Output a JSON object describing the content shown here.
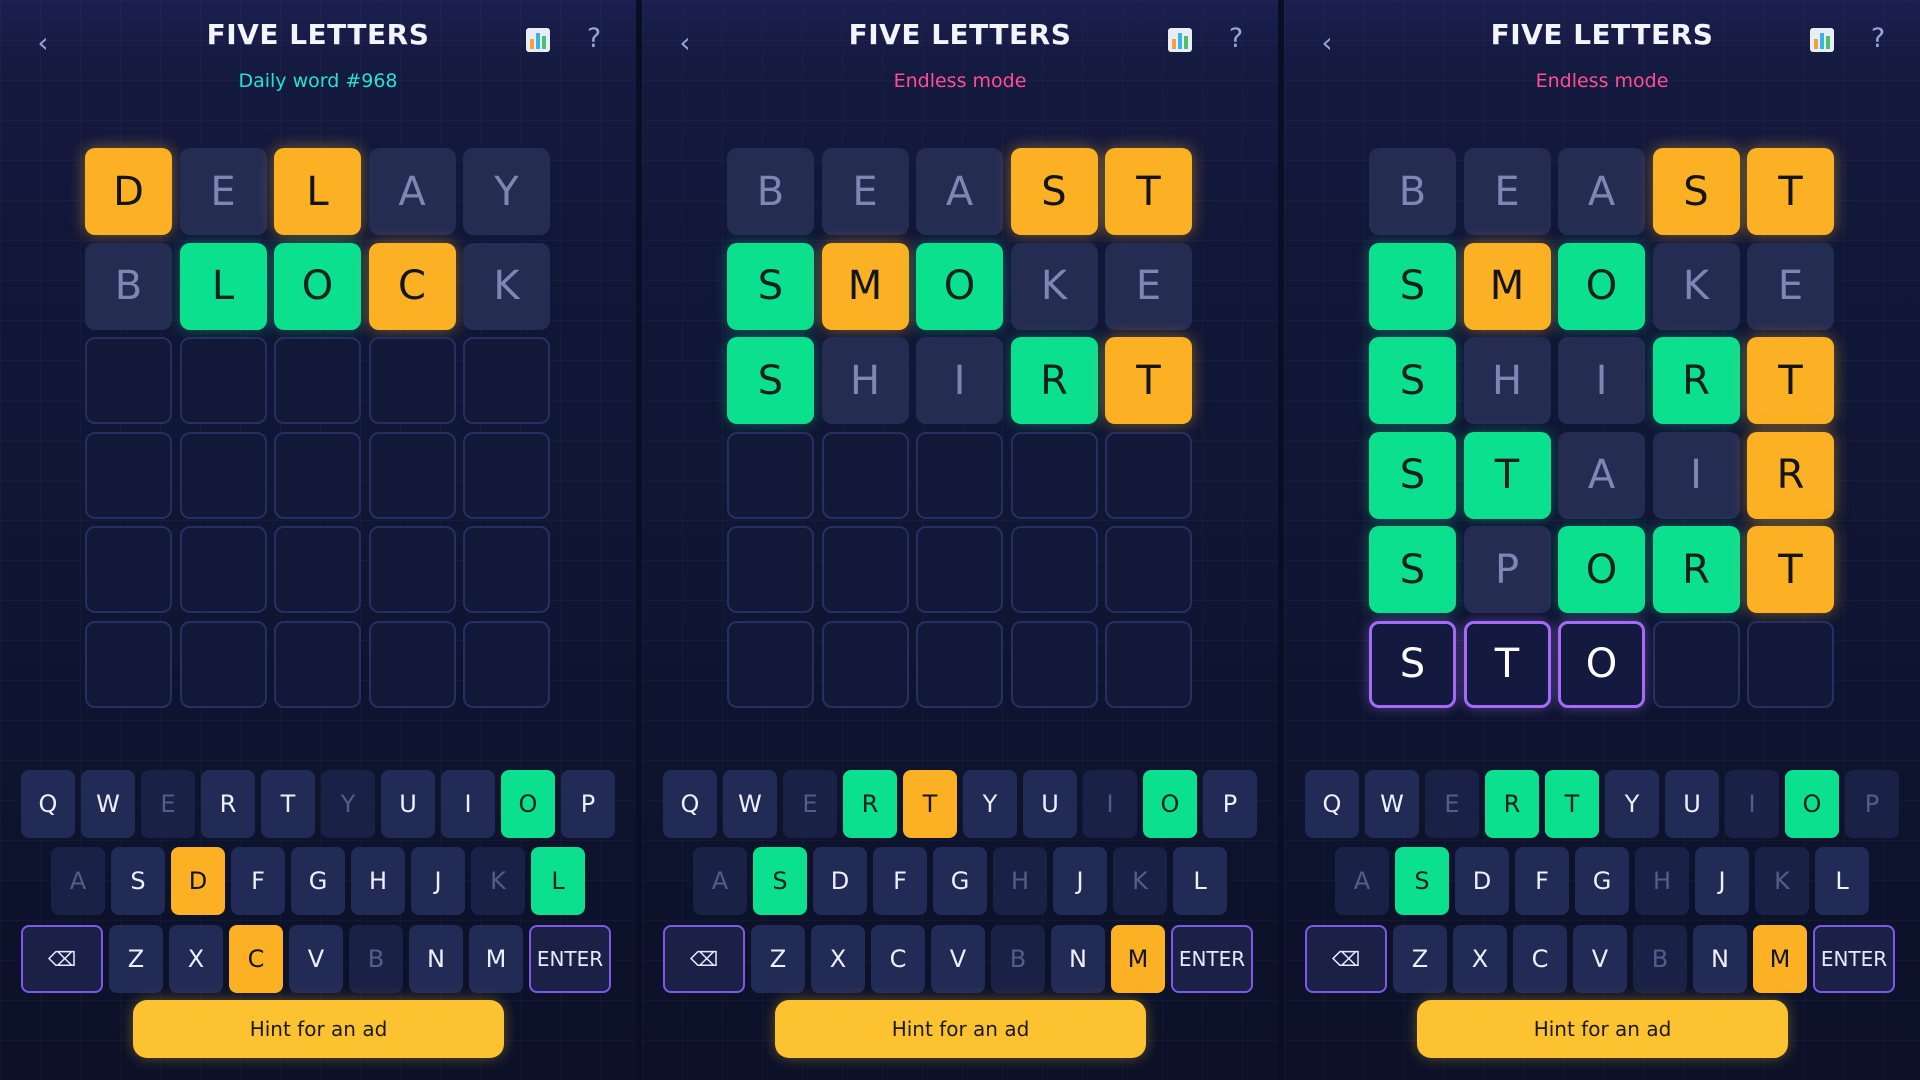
{
  "colors": {
    "present": "#fbb123",
    "correct": "#0be08f",
    "absent_tile": "#252c52",
    "daily_subtitle": "#26e3d0",
    "endless_subtitle": "#ff4f92",
    "hint_button": "#fcc22f"
  },
  "icons": {
    "back": "chevron-left-icon",
    "stats": "bar-chart-icon",
    "help": "question-mark-icon",
    "backspace": "backspace-icon"
  },
  "keyboard_layout": [
    [
      "Q",
      "W",
      "E",
      "R",
      "T",
      "Y",
      "U",
      "I",
      "O",
      "P"
    ],
    [
      "A",
      "S",
      "D",
      "F",
      "G",
      "H",
      "J",
      "K",
      "L"
    ],
    [
      "BACK",
      "Z",
      "X",
      "C",
      "V",
      "B",
      "N",
      "M",
      "ENTER"
    ]
  ],
  "panels": [
    {
      "title": "FIVE LETTERS",
      "subtitle": "Daily word #968",
      "subtitle_mode": "daily",
      "back_glyph": "‹",
      "help_glyph": "?",
      "board": [
        [
          [
            "D",
            "present"
          ],
          [
            "E",
            "absent"
          ],
          [
            "L",
            "present"
          ],
          [
            "A",
            "absent"
          ],
          [
            "Y",
            "absent"
          ]
        ],
        [
          [
            "B",
            "absent"
          ],
          [
            "L",
            "correct"
          ],
          [
            "O",
            "correct"
          ],
          [
            "C",
            "present"
          ],
          [
            "K",
            "absent"
          ]
        ],
        [
          [
            "",
            "empty"
          ],
          [
            "",
            "empty"
          ],
          [
            "",
            "empty"
          ],
          [
            "",
            "empty"
          ],
          [
            "",
            "empty"
          ]
        ],
        [
          [
            "",
            "empty"
          ],
          [
            "",
            "empty"
          ],
          [
            "",
            "empty"
          ],
          [
            "",
            "empty"
          ],
          [
            "",
            "empty"
          ]
        ],
        [
          [
            "",
            "empty"
          ],
          [
            "",
            "empty"
          ],
          [
            "",
            "empty"
          ],
          [
            "",
            "empty"
          ],
          [
            "",
            "empty"
          ]
        ],
        [
          [
            "",
            "empty"
          ],
          [
            "",
            "empty"
          ],
          [
            "",
            "empty"
          ],
          [
            "",
            "empty"
          ],
          [
            "",
            "empty"
          ]
        ]
      ],
      "key_states": {
        "E": "absent",
        "Y": "absent",
        "O": "correct",
        "A": "absent",
        "D": "present",
        "K": "absent",
        "L": "correct",
        "C": "present",
        "B": "absent"
      },
      "backspace_glyph": "⌫",
      "enter_label": "ENTER",
      "hint_label": "Hint for an ad"
    },
    {
      "title": "FIVE LETTERS",
      "subtitle": "Endless mode",
      "subtitle_mode": "endless",
      "back_glyph": "‹",
      "help_glyph": "?",
      "board": [
        [
          [
            "B",
            "absent"
          ],
          [
            "E",
            "absent"
          ],
          [
            "A",
            "absent"
          ],
          [
            "S",
            "present"
          ],
          [
            "T",
            "present"
          ]
        ],
        [
          [
            "S",
            "correct"
          ],
          [
            "M",
            "present"
          ],
          [
            "O",
            "correct"
          ],
          [
            "K",
            "absent"
          ],
          [
            "E",
            "absent"
          ]
        ],
        [
          [
            "S",
            "correct"
          ],
          [
            "H",
            "absent"
          ],
          [
            "I",
            "absent"
          ],
          [
            "R",
            "correct"
          ],
          [
            "T",
            "present"
          ]
        ],
        [
          [
            "",
            "empty"
          ],
          [
            "",
            "empty"
          ],
          [
            "",
            "empty"
          ],
          [
            "",
            "empty"
          ],
          [
            "",
            "empty"
          ]
        ],
        [
          [
            "",
            "empty"
          ],
          [
            "",
            "empty"
          ],
          [
            "",
            "empty"
          ],
          [
            "",
            "empty"
          ],
          [
            "",
            "empty"
          ]
        ],
        [
          [
            "",
            "empty"
          ],
          [
            "",
            "empty"
          ],
          [
            "",
            "empty"
          ],
          [
            "",
            "empty"
          ],
          [
            "",
            "empty"
          ]
        ]
      ],
      "key_states": {
        "E": "absent",
        "R": "correct",
        "T": "present",
        "I": "absent",
        "O": "correct",
        "A": "absent",
        "S": "correct",
        "H": "absent",
        "K": "absent",
        "B": "absent",
        "M": "present"
      },
      "backspace_glyph": "⌫",
      "enter_label": "ENTER",
      "hint_label": "Hint for an ad"
    },
    {
      "title": "FIVE LETTERS",
      "subtitle": "Endless mode",
      "subtitle_mode": "endless",
      "back_glyph": "‹",
      "help_glyph": "?",
      "board": [
        [
          [
            "B",
            "absent"
          ],
          [
            "E",
            "absent"
          ],
          [
            "A",
            "absent"
          ],
          [
            "S",
            "present"
          ],
          [
            "T",
            "present"
          ]
        ],
        [
          [
            "S",
            "correct"
          ],
          [
            "M",
            "present"
          ],
          [
            "O",
            "correct"
          ],
          [
            "K",
            "absent"
          ],
          [
            "E",
            "absent"
          ]
        ],
        [
          [
            "S",
            "correct"
          ],
          [
            "H",
            "absent"
          ],
          [
            "I",
            "absent"
          ],
          [
            "R",
            "correct"
          ],
          [
            "T",
            "present"
          ]
        ],
        [
          [
            "S",
            "correct"
          ],
          [
            "T",
            "correct"
          ],
          [
            "A",
            "absent"
          ],
          [
            "I",
            "absent"
          ],
          [
            "R",
            "present"
          ]
        ],
        [
          [
            "S",
            "correct"
          ],
          [
            "P",
            "absent"
          ],
          [
            "O",
            "correct"
          ],
          [
            "R",
            "correct"
          ],
          [
            "T",
            "present"
          ]
        ],
        [
          [
            "S",
            "typed"
          ],
          [
            "T",
            "typed"
          ],
          [
            "O",
            "typed"
          ],
          [
            "",
            "empty"
          ],
          [
            "",
            "empty"
          ]
        ]
      ],
      "key_states": {
        "E": "absent",
        "R": "correct",
        "T": "correct",
        "I": "absent",
        "O": "correct",
        "P": "absent",
        "A": "absent",
        "S": "correct",
        "H": "absent",
        "K": "absent",
        "B": "absent",
        "M": "present"
      },
      "backspace_glyph": "⌫",
      "enter_label": "ENTER",
      "hint_label": "Hint for an ad"
    }
  ]
}
